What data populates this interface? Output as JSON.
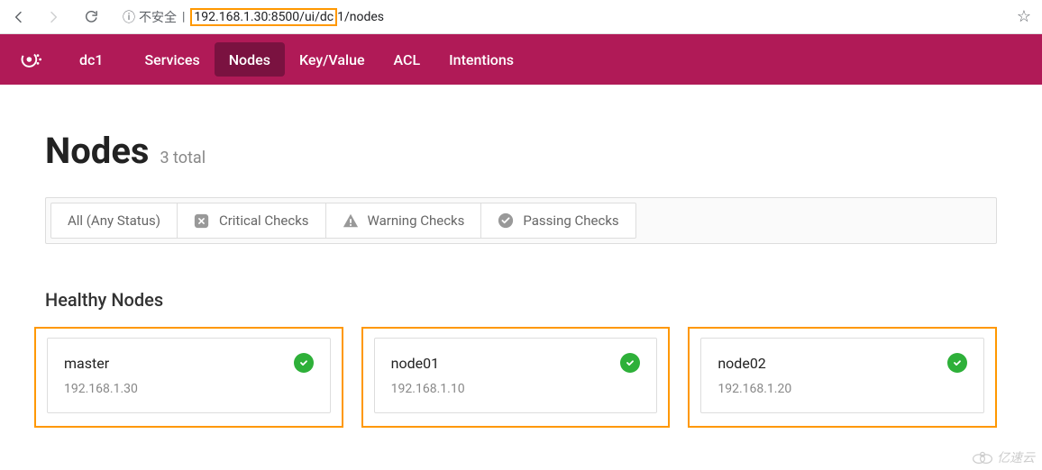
{
  "browser": {
    "insecure_label": "不安全",
    "url_highlighted": "192.168.1.30:8500/ui/dc",
    "url_rest": "1/nodes"
  },
  "nav": {
    "dc": "dc1",
    "items": [
      "Services",
      "Nodes",
      "Key/Value",
      "ACL",
      "Intentions"
    ],
    "active": "Nodes"
  },
  "page": {
    "title": "Nodes",
    "subtitle": "3 total"
  },
  "filters": {
    "all": "All (Any Status)",
    "critical": "Critical Checks",
    "warning": "Warning Checks",
    "passing": "Passing Checks"
  },
  "section": {
    "healthy_title": "Healthy Nodes"
  },
  "nodes": [
    {
      "name": "master",
      "ip": "192.168.1.30"
    },
    {
      "name": "node01",
      "ip": "192.168.1.10"
    },
    {
      "name": "node02",
      "ip": "192.168.1.20"
    }
  ],
  "watermark": "亿速云"
}
